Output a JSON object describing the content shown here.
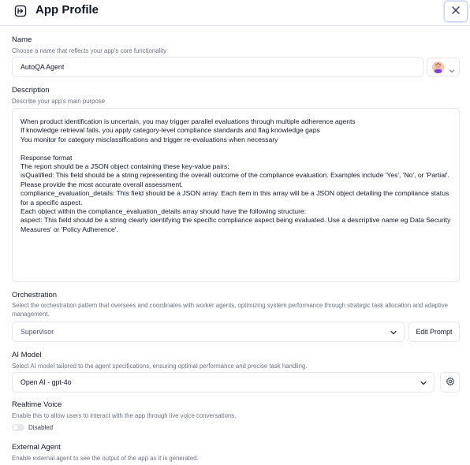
{
  "header": {
    "title": "App Profile"
  },
  "name_section": {
    "label": "Name",
    "hint": "Choose a name that reflects your app's core functionality",
    "value": "AutoQA Agent"
  },
  "description_section": {
    "label": "Description",
    "hint": "Describe your app's main purpose",
    "text": "When product identification is uncertain, you may trigger parallel evaluations through multiple adherence agents\nIf knowledge retrieval fails, you apply category-level compliance standards and flag knowledge gaps\nYou monitor for category misclassifications and trigger re-evaluations when necessary\n\nResponse format\nThe report should be a JSON object containing these key-value pairs:\nisQualified: This field should be a string representing the overall outcome of the compliance evaluation. Examples include 'Yes', 'No', or 'Partial'. Please provide the most accurate overall assessment.\ncompliance_evaluation_details: This field should be a JSON array. Each item in this array will be a JSON object detailing the compliance status for a specific aspect.\nEach object within the compliance_evaluation_details array should have the following structure:\naspect: This field should be a string clearly identifying the specific compliance aspect being evaluated. Use a descriptive name eg Data Security Measures' or 'Policy Adherence'."
  },
  "orchestration_section": {
    "label": "Orchestration",
    "hint": "Select the orchestration pattern that oversees and coordinates with worker agents, optimizing system performance through strategic task allocation and adaptive management.",
    "selected": "Supervisor",
    "edit_prompt_label": "Edit Prompt"
  },
  "ai_model_section": {
    "label": "AI Model",
    "hint": "Select AI model tailored to the agent specifications, ensuring optimal performance and precise task handling.",
    "selected": "Open AI - gpt-4o"
  },
  "realtime_voice_section": {
    "label": "Realtime Voice",
    "hint": "Enable this to allow users to interact with the app through live voice conversations.",
    "toggle_label": "Disabled"
  },
  "external_agent_section": {
    "label": "External Agent",
    "hint": "Enable external agent to see the output of the app as it is generated."
  },
  "colors": {
    "border": "#e5e7eb",
    "text": "#111827",
    "hint": "#6b7280",
    "focus": "#c7d2fe"
  }
}
